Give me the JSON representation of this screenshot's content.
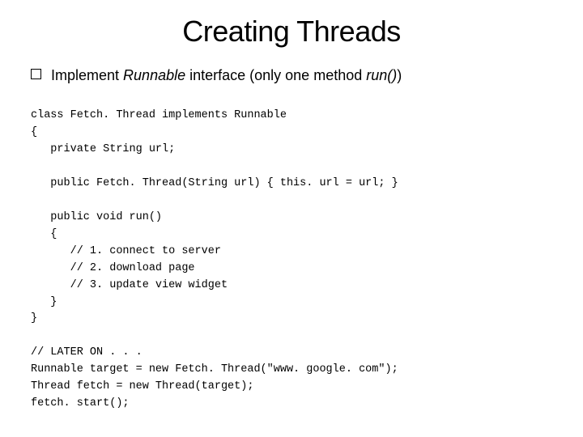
{
  "title": "Creating Threads",
  "bullet": {
    "prefix": "Implement ",
    "em1": "Runnable",
    "mid": " interface (only one method ",
    "em2": "run()",
    "suffix": ")"
  },
  "code": "class Fetch. Thread implements Runnable\n{\n   private String url;\n\n   public Fetch. Thread(String url) { this. url = url; }\n\n   public void run()\n   {\n      // 1. connect to server\n      // 2. download page\n      // 3. update view widget\n   }\n}\n\n// LATER ON . . .\nRunnable target = new Fetch. Thread(\"www. google. com\");\nThread fetch = new Thread(target);\nfetch. start();"
}
